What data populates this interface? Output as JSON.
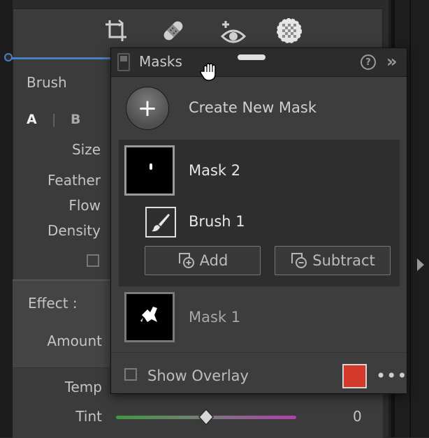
{
  "panel": {
    "brush_label": "Brush",
    "brush_a": "A",
    "brush_sep": "|",
    "brush_b": "B",
    "size_label": "Size",
    "feather_label": "Feather",
    "flow_label": "Flow",
    "density_label": "Density",
    "effect_label": "Effect :",
    "amount_label": "Amount",
    "temp_label": "Temp",
    "tint_label": "Tint",
    "tint_value": "0"
  },
  "toolbar": {
    "icons": [
      "crop-icon",
      "healing-icon",
      "redeye-icon",
      "masking-icon"
    ]
  },
  "masks_panel": {
    "title": "Masks",
    "help_icon": "?",
    "collapse_icon": "»",
    "create_new_mask_label": "Create New Mask",
    "masks": [
      {
        "name": "Mask 2",
        "selected": true,
        "components": [
          {
            "name": "Brush 1",
            "icon": "brush-icon"
          }
        ]
      },
      {
        "name": "Mask 1",
        "selected": false
      }
    ],
    "add_label": "Add",
    "subtract_label": "Subtract",
    "show_overlay_label": "Show Overlay",
    "show_overlay_checked": false,
    "overlay_color": "#d43a2c",
    "more_label": "•••"
  },
  "colors": {
    "accent_blue": "#4a7fc1",
    "panel_bg": "#3b3b3b",
    "popup_bg": "#3d3d3d"
  }
}
